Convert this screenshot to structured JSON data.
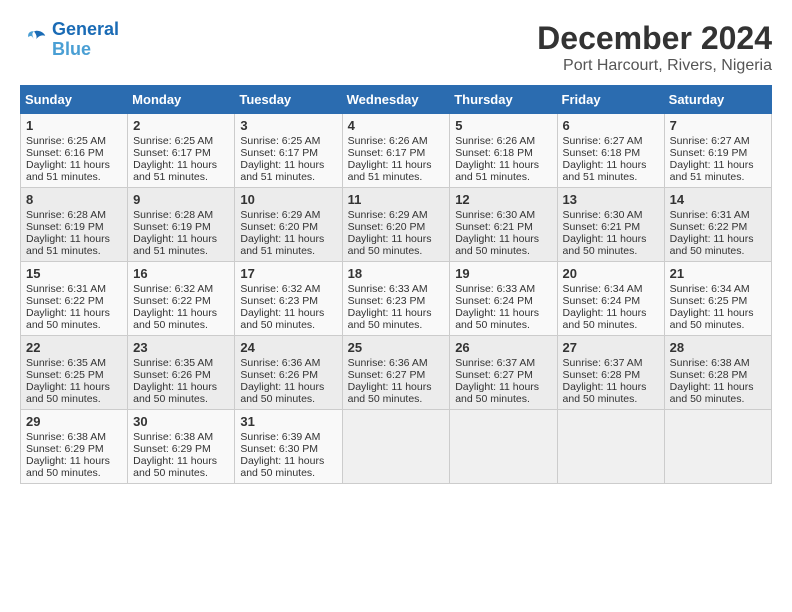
{
  "logo": {
    "line1": "General",
    "line2": "Blue"
  },
  "title": "December 2024",
  "subtitle": "Port Harcourt, Rivers, Nigeria",
  "weekdays": [
    "Sunday",
    "Monday",
    "Tuesday",
    "Wednesday",
    "Thursday",
    "Friday",
    "Saturday"
  ],
  "weeks": [
    [
      {
        "day": 1,
        "info": "Sunrise: 6:25 AM\nSunset: 6:16 PM\nDaylight: 11 hours\nand 51 minutes."
      },
      {
        "day": 2,
        "info": "Sunrise: 6:25 AM\nSunset: 6:17 PM\nDaylight: 11 hours\nand 51 minutes."
      },
      {
        "day": 3,
        "info": "Sunrise: 6:25 AM\nSunset: 6:17 PM\nDaylight: 11 hours\nand 51 minutes."
      },
      {
        "day": 4,
        "info": "Sunrise: 6:26 AM\nSunset: 6:17 PM\nDaylight: 11 hours\nand 51 minutes."
      },
      {
        "day": 5,
        "info": "Sunrise: 6:26 AM\nSunset: 6:18 PM\nDaylight: 11 hours\nand 51 minutes."
      },
      {
        "day": 6,
        "info": "Sunrise: 6:27 AM\nSunset: 6:18 PM\nDaylight: 11 hours\nand 51 minutes."
      },
      {
        "day": 7,
        "info": "Sunrise: 6:27 AM\nSunset: 6:19 PM\nDaylight: 11 hours\nand 51 minutes."
      }
    ],
    [
      {
        "day": 8,
        "info": "Sunrise: 6:28 AM\nSunset: 6:19 PM\nDaylight: 11 hours\nand 51 minutes."
      },
      {
        "day": 9,
        "info": "Sunrise: 6:28 AM\nSunset: 6:19 PM\nDaylight: 11 hours\nand 51 minutes."
      },
      {
        "day": 10,
        "info": "Sunrise: 6:29 AM\nSunset: 6:20 PM\nDaylight: 11 hours\nand 51 minutes."
      },
      {
        "day": 11,
        "info": "Sunrise: 6:29 AM\nSunset: 6:20 PM\nDaylight: 11 hours\nand 50 minutes."
      },
      {
        "day": 12,
        "info": "Sunrise: 6:30 AM\nSunset: 6:21 PM\nDaylight: 11 hours\nand 50 minutes."
      },
      {
        "day": 13,
        "info": "Sunrise: 6:30 AM\nSunset: 6:21 PM\nDaylight: 11 hours\nand 50 minutes."
      },
      {
        "day": 14,
        "info": "Sunrise: 6:31 AM\nSunset: 6:22 PM\nDaylight: 11 hours\nand 50 minutes."
      }
    ],
    [
      {
        "day": 15,
        "info": "Sunrise: 6:31 AM\nSunset: 6:22 PM\nDaylight: 11 hours\nand 50 minutes."
      },
      {
        "day": 16,
        "info": "Sunrise: 6:32 AM\nSunset: 6:22 PM\nDaylight: 11 hours\nand 50 minutes."
      },
      {
        "day": 17,
        "info": "Sunrise: 6:32 AM\nSunset: 6:23 PM\nDaylight: 11 hours\nand 50 minutes."
      },
      {
        "day": 18,
        "info": "Sunrise: 6:33 AM\nSunset: 6:23 PM\nDaylight: 11 hours\nand 50 minutes."
      },
      {
        "day": 19,
        "info": "Sunrise: 6:33 AM\nSunset: 6:24 PM\nDaylight: 11 hours\nand 50 minutes."
      },
      {
        "day": 20,
        "info": "Sunrise: 6:34 AM\nSunset: 6:24 PM\nDaylight: 11 hours\nand 50 minutes."
      },
      {
        "day": 21,
        "info": "Sunrise: 6:34 AM\nSunset: 6:25 PM\nDaylight: 11 hours\nand 50 minutes."
      }
    ],
    [
      {
        "day": 22,
        "info": "Sunrise: 6:35 AM\nSunset: 6:25 PM\nDaylight: 11 hours\nand 50 minutes."
      },
      {
        "day": 23,
        "info": "Sunrise: 6:35 AM\nSunset: 6:26 PM\nDaylight: 11 hours\nand 50 minutes."
      },
      {
        "day": 24,
        "info": "Sunrise: 6:36 AM\nSunset: 6:26 PM\nDaylight: 11 hours\nand 50 minutes."
      },
      {
        "day": 25,
        "info": "Sunrise: 6:36 AM\nSunset: 6:27 PM\nDaylight: 11 hours\nand 50 minutes."
      },
      {
        "day": 26,
        "info": "Sunrise: 6:37 AM\nSunset: 6:27 PM\nDaylight: 11 hours\nand 50 minutes."
      },
      {
        "day": 27,
        "info": "Sunrise: 6:37 AM\nSunset: 6:28 PM\nDaylight: 11 hours\nand 50 minutes."
      },
      {
        "day": 28,
        "info": "Sunrise: 6:38 AM\nSunset: 6:28 PM\nDaylight: 11 hours\nand 50 minutes."
      }
    ],
    [
      {
        "day": 29,
        "info": "Sunrise: 6:38 AM\nSunset: 6:29 PM\nDaylight: 11 hours\nand 50 minutes."
      },
      {
        "day": 30,
        "info": "Sunrise: 6:38 AM\nSunset: 6:29 PM\nDaylight: 11 hours\nand 50 minutes."
      },
      {
        "day": 31,
        "info": "Sunrise: 6:39 AM\nSunset: 6:30 PM\nDaylight: 11 hours\nand 50 minutes."
      },
      {
        "day": null,
        "info": ""
      },
      {
        "day": null,
        "info": ""
      },
      {
        "day": null,
        "info": ""
      },
      {
        "day": null,
        "info": ""
      }
    ]
  ]
}
